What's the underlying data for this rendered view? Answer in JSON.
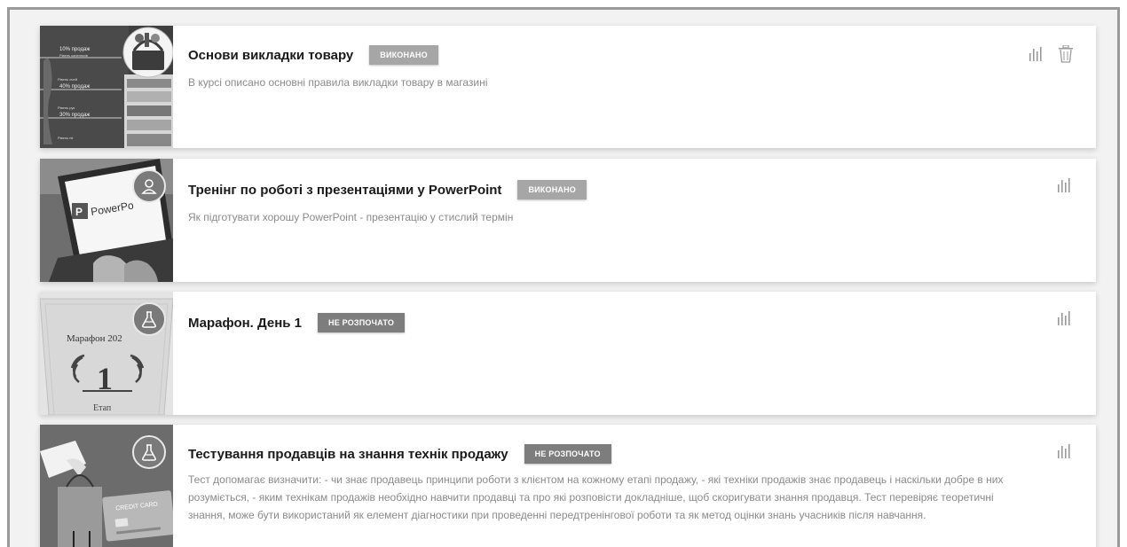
{
  "courses": [
    {
      "title": "Основи викладки товару",
      "status": "ВИКОНАНО",
      "description": "В курсі описано основні правила викладки товару в магазині",
      "thumb_texts": [
        "10% продаж",
        "Рівень капелюхів",
        "Рівень очей",
        "40% продаж",
        "Рівень рук",
        "30% продаж",
        "Рівень ніг"
      ],
      "actions": [
        "stats-icon",
        "trash-icon"
      ]
    },
    {
      "title": "Тренінг по роботі з презентаціями у PowerPoint",
      "status": "ВИКОНАНО",
      "description": "Як підготувати хорошу PowerPoint - презентацію у стислий термін",
      "thumb_texts": [
        "PowerPo"
      ],
      "actions": [
        "stats-icon"
      ]
    },
    {
      "title": "Марафон. День 1",
      "status": "НЕ РОЗПОЧАТО",
      "description": "",
      "thumb_texts": [
        "Марафон 202",
        "1",
        "Етап"
      ],
      "actions": [
        "stats-icon"
      ]
    },
    {
      "title": "Тестування продавців на знання технік продажу",
      "status": "НЕ РОЗПОЧАТО",
      "description": "Тест допомагає визначити: - чи знає продавець принципи роботи з клієнтом на кожному етапі продажу, - які техніки продажів знає продавець і наскільки добре в них розуміється, - яким технікам продажів необхідно навчити продавці та про які розповісти докладніше, щоб скоригувати знання продавця. Тест перевіряє теоретичні знання, може бути використаний як елемент діагностики при проведенні передтренінгової роботи та як метод оцінки знань учасників після навчання.",
      "thumb_texts": [
        "CREDIT CARD"
      ],
      "actions": [
        "stats-icon"
      ]
    }
  ]
}
